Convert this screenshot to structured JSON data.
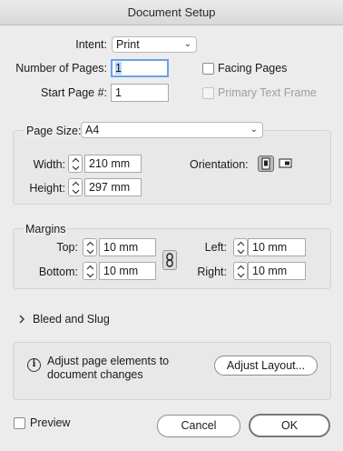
{
  "window": {
    "title": "Document Setup"
  },
  "intent": {
    "label": "Intent:",
    "value": "Print"
  },
  "pages": {
    "number_label": "Number of Pages:",
    "number_value": "1",
    "start_label": "Start Page #:",
    "start_value": "1",
    "facing_label": "Facing Pages",
    "facing_checked": false,
    "primary_label": "Primary Text Frame",
    "primary_checked": false,
    "primary_enabled": false
  },
  "page_size": {
    "label": "Page Size:",
    "value": "A4",
    "width_label": "Width:",
    "width_value": "210 mm",
    "height_label": "Height:",
    "height_value": "297 mm",
    "orientation_label": "Orientation:",
    "orientation_selected": "portrait",
    "portrait_icon": "portrait-orientation-icon",
    "landscape_icon": "landscape-orientation-icon"
  },
  "margins": {
    "title": "Margins",
    "top_label": "Top:",
    "top_value": "10 mm",
    "bottom_label": "Bottom:",
    "bottom_value": "10 mm",
    "left_label": "Left:",
    "left_value": "10 mm",
    "right_label": "Right:",
    "right_value": "10 mm",
    "link_icon": "chain-link-icon"
  },
  "bleed": {
    "label": "Bleed and Slug",
    "expanded": false
  },
  "adjust": {
    "text": "Adjust page elements to document changes",
    "line1": "Adjust page elements to",
    "line2": "document changes",
    "button": "Adjust Layout..."
  },
  "footer": {
    "preview_label": "Preview",
    "preview_checked": false,
    "cancel": "Cancel",
    "ok": "OK"
  },
  "colors": {
    "focus": "#6aa0e8",
    "selection": "#b5d5ff",
    "background": "#ececec"
  }
}
